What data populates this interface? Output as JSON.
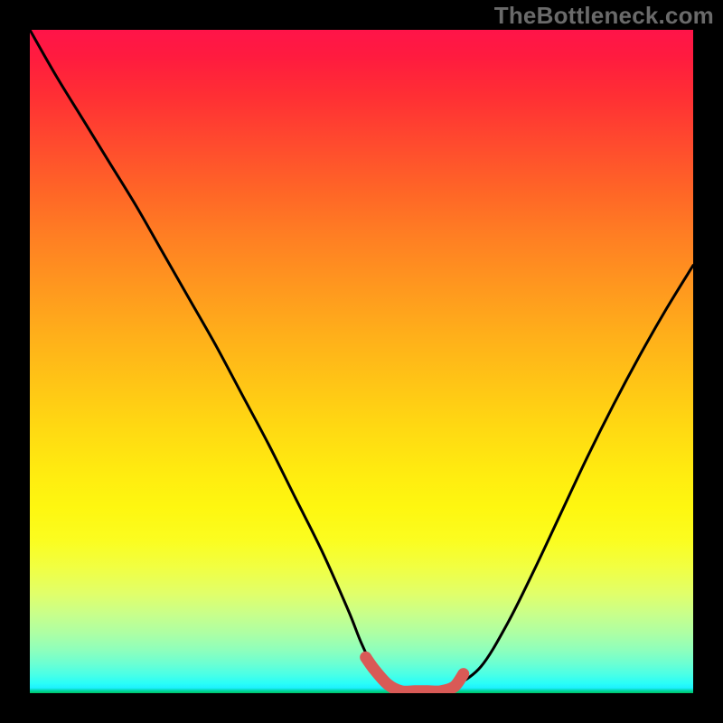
{
  "watermark": "TheBottleneck.com",
  "colors": {
    "background": "#000000",
    "curve": "#000000",
    "valley_accent": "#d95a56",
    "watermark_text": "#6a6a6a"
  },
  "chart_data": {
    "type": "line",
    "title": "",
    "xlabel": "",
    "ylabel": "",
    "xlim": [
      0,
      100
    ],
    "ylim": [
      0,
      100
    ],
    "grid": false,
    "series": [
      {
        "name": "bottleneck-curve",
        "x": [
          0,
          4,
          8,
          12,
          16,
          20,
          24,
          28,
          32,
          36,
          40,
          44,
          48,
          50,
          52,
          54,
          56,
          58,
          60,
          62,
          64,
          68,
          72,
          76,
          80,
          84,
          88,
          92,
          96,
          100
        ],
        "y": [
          100,
          93,
          86.5,
          80,
          73.5,
          66.5,
          59.5,
          52.5,
          45,
          37.5,
          29.5,
          21.5,
          12.5,
          7.5,
          3.5,
          1.3,
          0.3,
          0,
          0,
          0.2,
          1,
          4,
          10.5,
          18.5,
          27,
          35.5,
          43.5,
          51,
          58,
          64.5
        ]
      }
    ],
    "annotations": [
      {
        "name": "valley-flat-accent",
        "type": "highlight",
        "x_range": [
          52,
          65
        ],
        "y_approx": 0.3,
        "color": "#d95a56"
      }
    ]
  }
}
